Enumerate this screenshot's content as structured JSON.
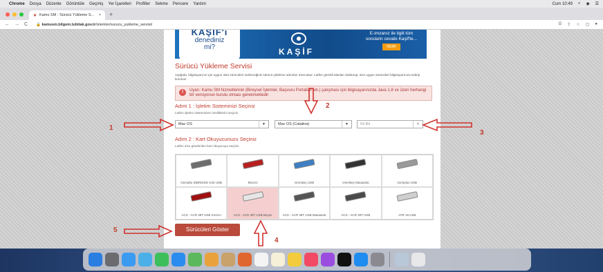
{
  "menubar": {
    "app": "Chrome",
    "items": [
      "Dosya",
      "Düzenle",
      "Görüntüle",
      "Geçmiş",
      "Yer İşaretleri",
      "Profiller",
      "Sekme",
      "Pencere",
      "Yardım"
    ],
    "clock": "Cum 10:49"
  },
  "browser": {
    "tab_title": "Kamu SM - Sürücü Yükleme S...",
    "url_host": "kamusm.bilgem.tubitak.gov.tr",
    "url_path": "/islemler/surucu_yukleme_servisi/"
  },
  "banner": {
    "left_title": "KAŞİF'i",
    "left_line2": "denediniz",
    "left_line3": "mi?",
    "center_title": "KAŞİF",
    "right_line1": "E-imzanız ile ilgili tüm",
    "right_line2": "sorularin cevabı Kaşif'te...",
    "button": "İNDİR"
  },
  "page": {
    "title": "Sürücü Yükleme Servisi",
    "description": "Aşağıda, bilgisayarınız için uygun olan sürücüleri indireceğiniz sürücü yükleme adımları mevcuttur. Lütfen gerekli alanları doldurup, size uygun sürücüleri bilgisayarınıza indirip kurunuz.",
    "warning": "Uyarı: Kamu SM hizmetlerinin (Bireysel İşlemler, Başvuru Portalları vb.) çalışması için bilgisayarınızda Java 1.8 ve üzeri herhangi bir versiyonun kurulu olması gerekmektedir",
    "step1_title": "Adım 1 : İşletim Sisteminizi Seçiniz",
    "step1_sub": "Lütfen işletim sisteminizin özelliklerini seçiniz.",
    "os_select": "Mac OS",
    "version_select": "Mac OS (Catalina)",
    "bit_select": "64 Bit",
    "step2_title": "Adım 2 : Kart Okuyucunuzu Seçiniz",
    "step2_sub": "Lütfen size gönderilen kart okuyucuyu seçiniz.",
    "readers": [
      {
        "label": "Gemalto IDBRIDGE K30 USB",
        "color": "#6d6d6d"
      },
      {
        "label": "MILKO",
        "color": "#b82020"
      },
      {
        "label": "Omnikey USB",
        "color": "#3d7fc2"
      },
      {
        "label": "Omnikey Masaüstü",
        "color": "#333333"
      },
      {
        "label": "Gemplus USB",
        "color": "#9a9a9a"
      },
      {
        "label": "ACS - ACR 38T USB Kırmızı",
        "color": "#a01010"
      },
      {
        "label": "ACS - ACR 38T USB Beyaz",
        "color": "#e6e6e6"
      },
      {
        "label": "ACS - ACR 38T USB Masaüstü",
        "color": "#555555"
      },
      {
        "label": "ACS - ACR 39T USB",
        "color": "#4a4a4a"
      },
      {
        "label": "ATR 19 USB",
        "color": "#cfcfcf"
      }
    ],
    "submit": "Sürücüleri Göster"
  },
  "annotations": [
    "1",
    "2",
    "3",
    "4",
    "5"
  ],
  "accent": "#c0392b"
}
